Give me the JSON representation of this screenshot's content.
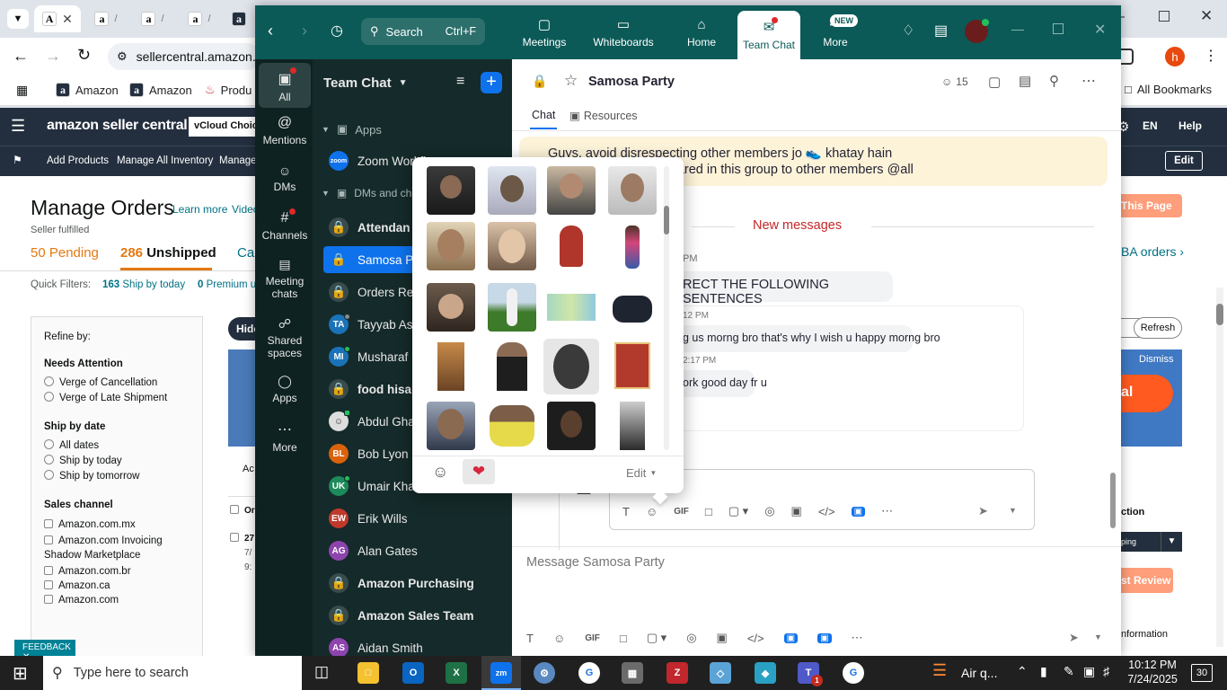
{
  "chrome": {
    "tabs": [
      {
        "label": "A"
      },
      {
        "label": "a"
      },
      {
        "label": "a"
      },
      {
        "label": "a"
      },
      {
        "label": "a"
      }
    ],
    "url": "sellercentral.amazon.",
    "profile_initial": "h",
    "bookmarks": [
      "Amazon",
      "Amazon",
      "Produ"
    ],
    "all_bookmarks": "All Bookmarks"
  },
  "amazon": {
    "logo": "amazon seller central",
    "store": "vCloud Choice",
    "lang": "EN",
    "help": "Help",
    "subnav": [
      "Add Products",
      "Manage All Inventory",
      "Manage"
    ],
    "edit": "Edit",
    "page_title": "Manage Orders",
    "learn_more": "Learn more",
    "video": "Video",
    "fulfilled": "Seller fulfilled",
    "tab_pending": "50 Pending",
    "tab_unshipped_count": "286",
    "tab_unshipped": "Unshipped",
    "tab_cancel": "Ca",
    "quick_filters": "Quick Filters:",
    "qf1_count": "163",
    "qf1": "Ship by today",
    "qf2_count": "0",
    "qf2": "Premium u",
    "refine": "Refine by:",
    "needs_attention": "Needs Attention",
    "na": [
      "Verge of Cancellation",
      "Verge of Late Shipment"
    ],
    "ship_by": "Ship by date",
    "sb": [
      "All dates",
      "Ship by today",
      "Ship by tomorrow"
    ],
    "sales_channel": "Sales channel",
    "sc": [
      "Amazon.com.mx",
      "Amazon.com Invoicing Shadow Marketplace",
      "Amazon.com.br",
      "Amazon.ca",
      "Amazon.com"
    ],
    "hide": "Hide",
    "this_page": "This Page",
    "fba_orders": "BA orders",
    "refresh": "Refresh",
    "dismiss": "Dismiss",
    "al": "al",
    "ac": "Ac",
    "or": "Or",
    "row_num": "27",
    "row_d1": "7/",
    "row_d2": "9:",
    "action": "ction",
    "ping": "ping",
    "review": "st Review",
    "information": "nformation",
    "feedback": "FEEDBACK"
  },
  "zoom": {
    "search": "Search",
    "search_shortcut": "Ctrl+F",
    "nav": [
      {
        "label": "Meetings"
      },
      {
        "label": "Whiteboards"
      },
      {
        "label": "Home"
      },
      {
        "label": "Team Chat"
      },
      {
        "label": "More"
      }
    ],
    "new_badge": "NEW",
    "rail": [
      {
        "label": "All"
      },
      {
        "label": "Mentions"
      },
      {
        "label": "DMs"
      },
      {
        "label": "Channels"
      },
      {
        "label": "Meeting chats"
      },
      {
        "label": "Shared spaces"
      },
      {
        "label": "Apps"
      },
      {
        "label": "More"
      }
    ],
    "list_title": "Team Chat",
    "sections": {
      "apps": "Apps",
      "dms": "DMs and ch"
    },
    "items": [
      {
        "label": "Zoom Workflow"
      },
      {
        "label": "Attendan"
      },
      {
        "label": "Samosa P"
      },
      {
        "label": "Orders Re"
      },
      {
        "label": "Tayyab As",
        "initials": "TA"
      },
      {
        "label": "Musharaf",
        "initials": "MI"
      },
      {
        "label": "food hisa"
      },
      {
        "label": "Abdul Gha"
      },
      {
        "label": "Bob Lyon",
        "initials": "BL"
      },
      {
        "label": "Umair Kha",
        "initials": "UK"
      },
      {
        "label": "Erik Wills",
        "initials": "EW"
      },
      {
        "label": "Alan Gates",
        "initials": "AG"
      },
      {
        "label": "Amazon Purchasing"
      },
      {
        "label": "Amazon Sales Team"
      },
      {
        "label": "Aidan Smith",
        "initials": "AS"
      }
    ],
    "zoom_badge": "zoom",
    "channel": {
      "name": "Samosa Party",
      "members": "15",
      "tabs": {
        "chat": "Chat",
        "resources": "Resources"
      },
      "pinned_line1": "Guys, avoid disrespecting other members jo 👟 khatay hain",
      "pinned_line2": "ny picture and vdo shared in this group to other members @all",
      "new_messages": "New messages",
      "time1": "PM",
      "msg1": "RECT THE FOLLOWING SENTENCES",
      "time2": "12 PM",
      "msg2": "g us morng bro that's why I wish u happy morng bro",
      "time3": "2:17 PM",
      "msg3": "ork good day fr u",
      "composer_placeholder": "Message Samosa Party"
    },
    "picker": {
      "edit": "Edit"
    }
  },
  "taskbar": {
    "search": "Type here to search",
    "weather": "Air q...",
    "time": "10:12 PM",
    "date": "7/24/2025",
    "notif": "30",
    "teams_badge": "1"
  }
}
